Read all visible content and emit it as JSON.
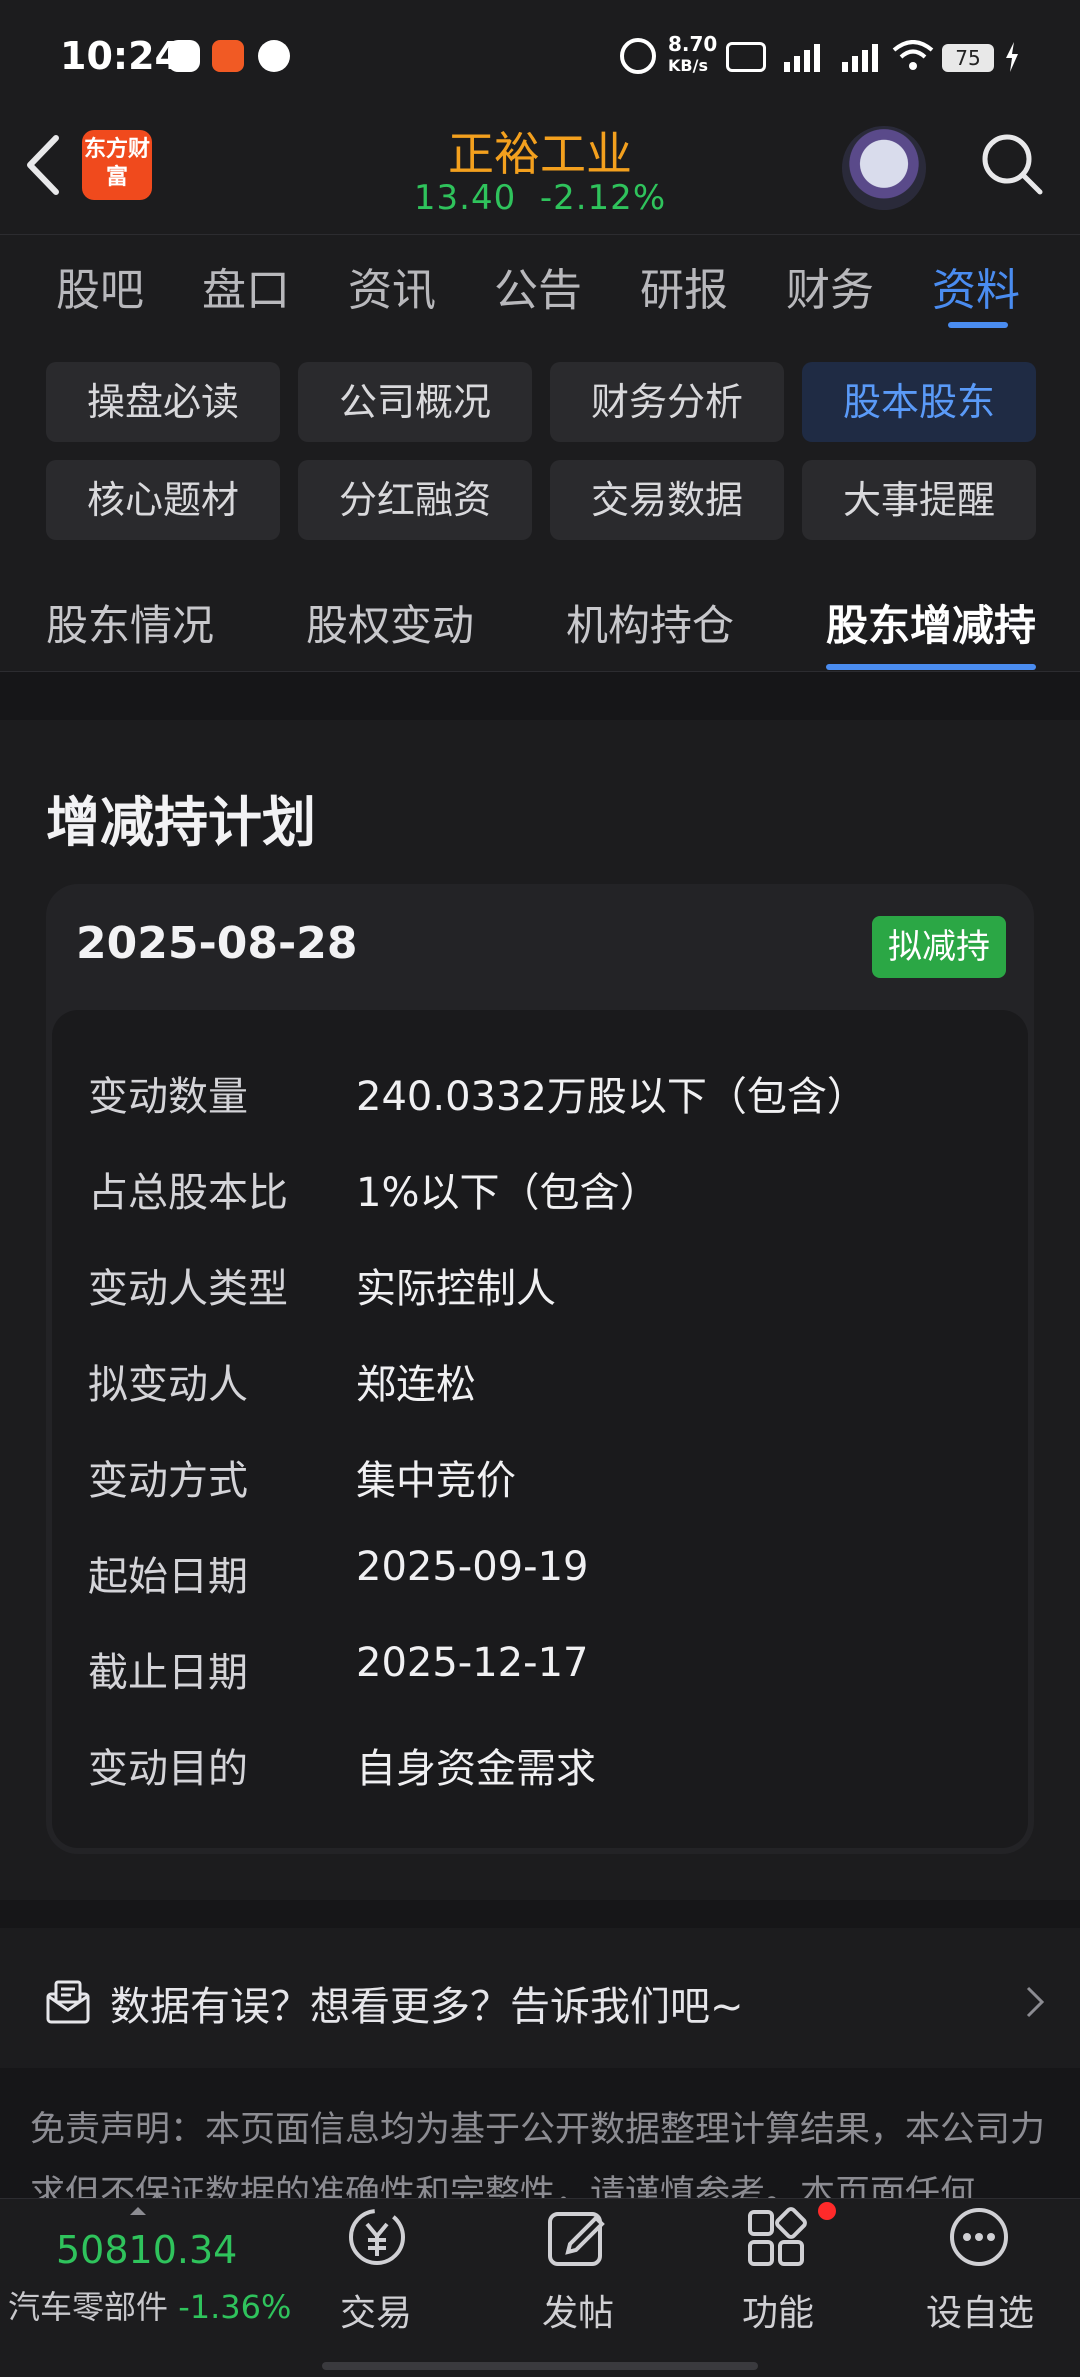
{
  "status_bar": {
    "time": "10:24",
    "net_speed": "8.70",
    "net_unit": "KB/s",
    "battery": "75"
  },
  "header": {
    "logo_text": "东方财富",
    "stock_name": "正裕工业",
    "price": "13.40",
    "change": "-2.12%"
  },
  "tabs": [
    "股吧",
    "盘口",
    "资讯",
    "公告",
    "研报",
    "财务",
    "资料"
  ],
  "active_tab": "资料",
  "chips": [
    [
      "操盘必读",
      "公司概况",
      "财务分析",
      "股本股东"
    ],
    [
      "核心题材",
      "分红融资",
      "交易数据",
      "大事提醒"
    ]
  ],
  "active_chip": "股本股东",
  "subtabs": [
    "股东情况",
    "股权变动",
    "机构持仓",
    "股东增减持"
  ],
  "active_subtab": "股东增减持",
  "section": {
    "title": "增减持计划",
    "card": {
      "date": "2025-08-28",
      "badge": "拟减持",
      "rows": [
        {
          "label": "变动数量",
          "value": "240.0332万股以下（包含）"
        },
        {
          "label": "占总股本比",
          "value": "1%以下（包含）"
        },
        {
          "label": "变动人类型",
          "value": "实际控制人"
        },
        {
          "label": "拟变动人",
          "value": "郑连松"
        },
        {
          "label": "变动方式",
          "value": "集中竞价"
        },
        {
          "label": "起始日期",
          "value": "2025-09-19"
        },
        {
          "label": "截止日期",
          "value": "2025-12-17"
        },
        {
          "label": "变动目的",
          "value": "自身资金需求"
        }
      ]
    }
  },
  "feedback": {
    "text": "数据有误？想看更多？告诉我们吧~"
  },
  "disclaimer": "免责声明：本页面信息均为基于公开数据整理计算结果，本公司力求但不保证数据的准确性和完整性，请谨慎参考。本页面任何",
  "bottom_bar": {
    "index_value": "50810.34",
    "index_name": "汽车零部件",
    "index_change": "-1.36%",
    "nav": [
      "交易",
      "发帖",
      "功能",
      "设自选"
    ]
  },
  "colors": {
    "accent": "#4a8cf0",
    "stock_name": "#f3a01e",
    "down": "#2fc35c",
    "badge": "#2ba745",
    "logo": "#f04a1d"
  }
}
